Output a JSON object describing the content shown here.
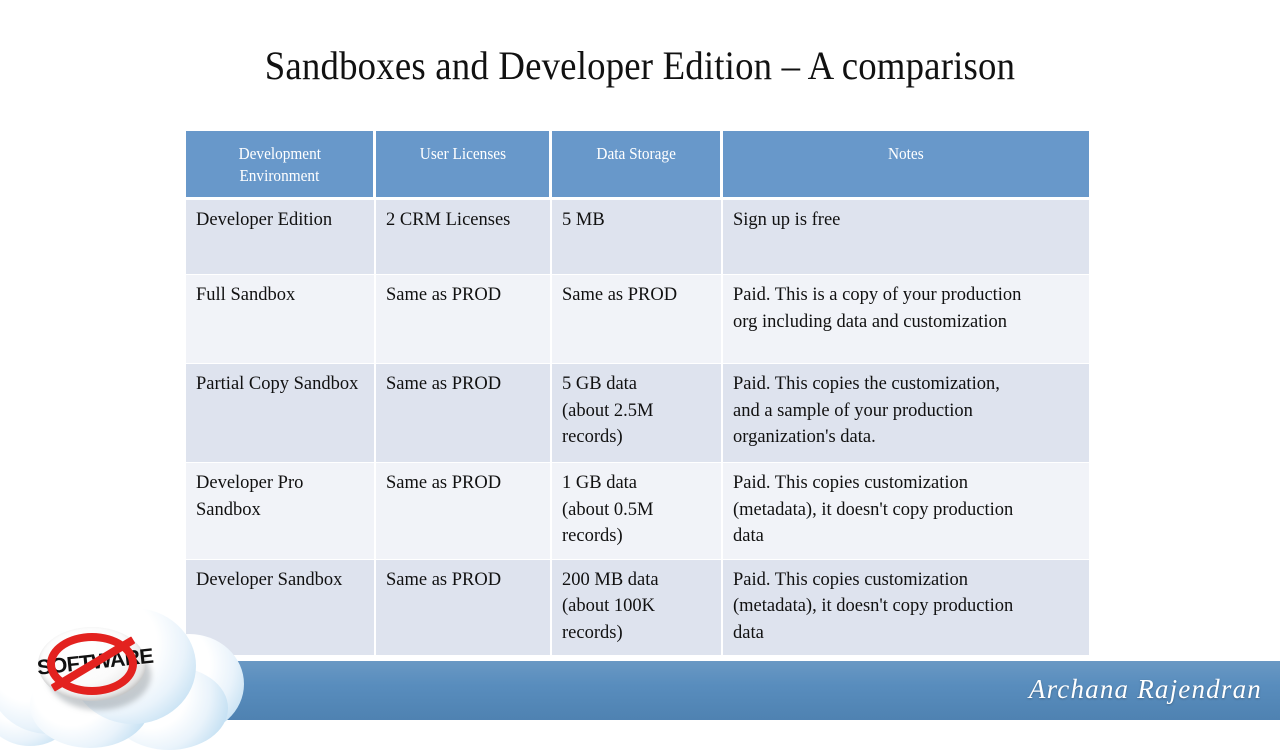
{
  "slide": {
    "title": "Sandboxes and Developer Edition – A comparison",
    "accent_blue": "#5389bb",
    "header_blue": "#6898ca",
    "row_shade": "#dee3ee",
    "row_light": "#f1f3f8"
  },
  "table": {
    "columns": [
      {
        "label_line1": "Development",
        "label_line2": "Environment"
      },
      {
        "label_line1": "User Licenses",
        "label_line2": ""
      },
      {
        "label_line1": "Data Storage",
        "label_line2": ""
      },
      {
        "label_line1": "Notes",
        "label_line2": ""
      }
    ],
    "rows": [
      {
        "environment": "Developer Edition",
        "user_licenses": "2 CRM Licenses",
        "data_storage_line1": "5 MB",
        "data_storage_line2": "",
        "data_storage_line3": "",
        "notes_line1": "Sign up is free",
        "notes_line2": "",
        "notes_line3": ""
      },
      {
        "environment": "Full Sandbox",
        "user_licenses": "Same as PROD",
        "data_storage_line1": "Same as PROD",
        "data_storage_line2": "",
        "data_storage_line3": "",
        "notes_line1": "Paid. This is a copy of your production",
        "notes_line2": "org including data and customization",
        "notes_line3": ""
      },
      {
        "environment": "Partial Copy Sandbox",
        "user_licenses": "Same as PROD",
        "data_storage_line1": "5 GB data",
        "data_storage_line2": "(about 2.5M",
        "data_storage_line3": "records)",
        "notes_line1": "Paid. This copies the customization,",
        "notes_line2": "and a sample of your production",
        "notes_line3": "organization's data."
      },
      {
        "environment": "Developer Pro Sandbox",
        "user_licenses": "Same as PROD",
        "data_storage_line1": "1 GB data",
        "data_storage_line2": "(about 0.5M",
        "data_storage_line3": "records)",
        "notes_line1": "Paid. This copies customization",
        "notes_line2": "(metadata), it doesn't copy production",
        "notes_line3": "data"
      },
      {
        "environment": "Developer Sandbox",
        "user_licenses": "Same as PROD",
        "data_storage_line1": "200 MB data",
        "data_storage_line2": "(about 100K",
        "data_storage_line3": "records)",
        "notes_line1": "Paid. This copies customization",
        "notes_line2": "(metadata), it doesn't copy production",
        "notes_line3": "data"
      }
    ]
  },
  "footer": {
    "signature": "Archana Rajendran"
  },
  "logo": {
    "badge_text": "SOFTWARE",
    "badge_ring_color": "#e3221f",
    "icon_name": "no-software-cloud-logo"
  }
}
